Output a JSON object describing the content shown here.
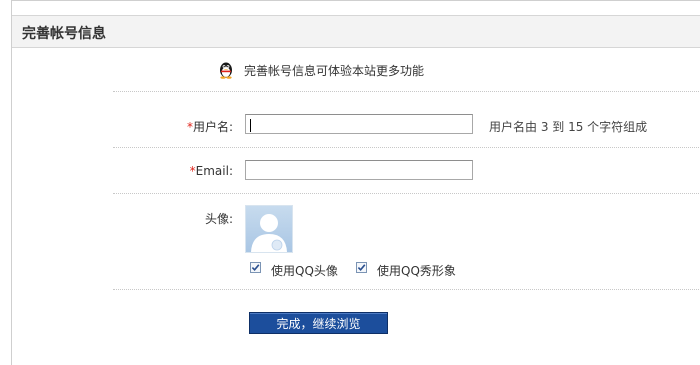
{
  "header": {
    "title": "完善帐号信息"
  },
  "intro": {
    "icon": "qq-penguin-icon",
    "text": "完善帐号信息可体验本站更多功能"
  },
  "form": {
    "username": {
      "required_mark": "*",
      "label": "用户名:",
      "value": "",
      "hint": "用户名由 3 到 15 个字符组成"
    },
    "email": {
      "required_mark": "*",
      "label": "Email:",
      "value": ""
    },
    "avatar": {
      "label": "头像:",
      "image": "default-avatar-icon",
      "options": [
        {
          "label": "使用QQ头像",
          "checked": true
        },
        {
          "label": "使用QQ秀形象",
          "checked": true
        }
      ]
    },
    "submit_label": "完成，继续浏览"
  },
  "colors": {
    "accent": "#1c4e9c",
    "required": "#e0241b",
    "header_bg": "#f3f3f3"
  }
}
